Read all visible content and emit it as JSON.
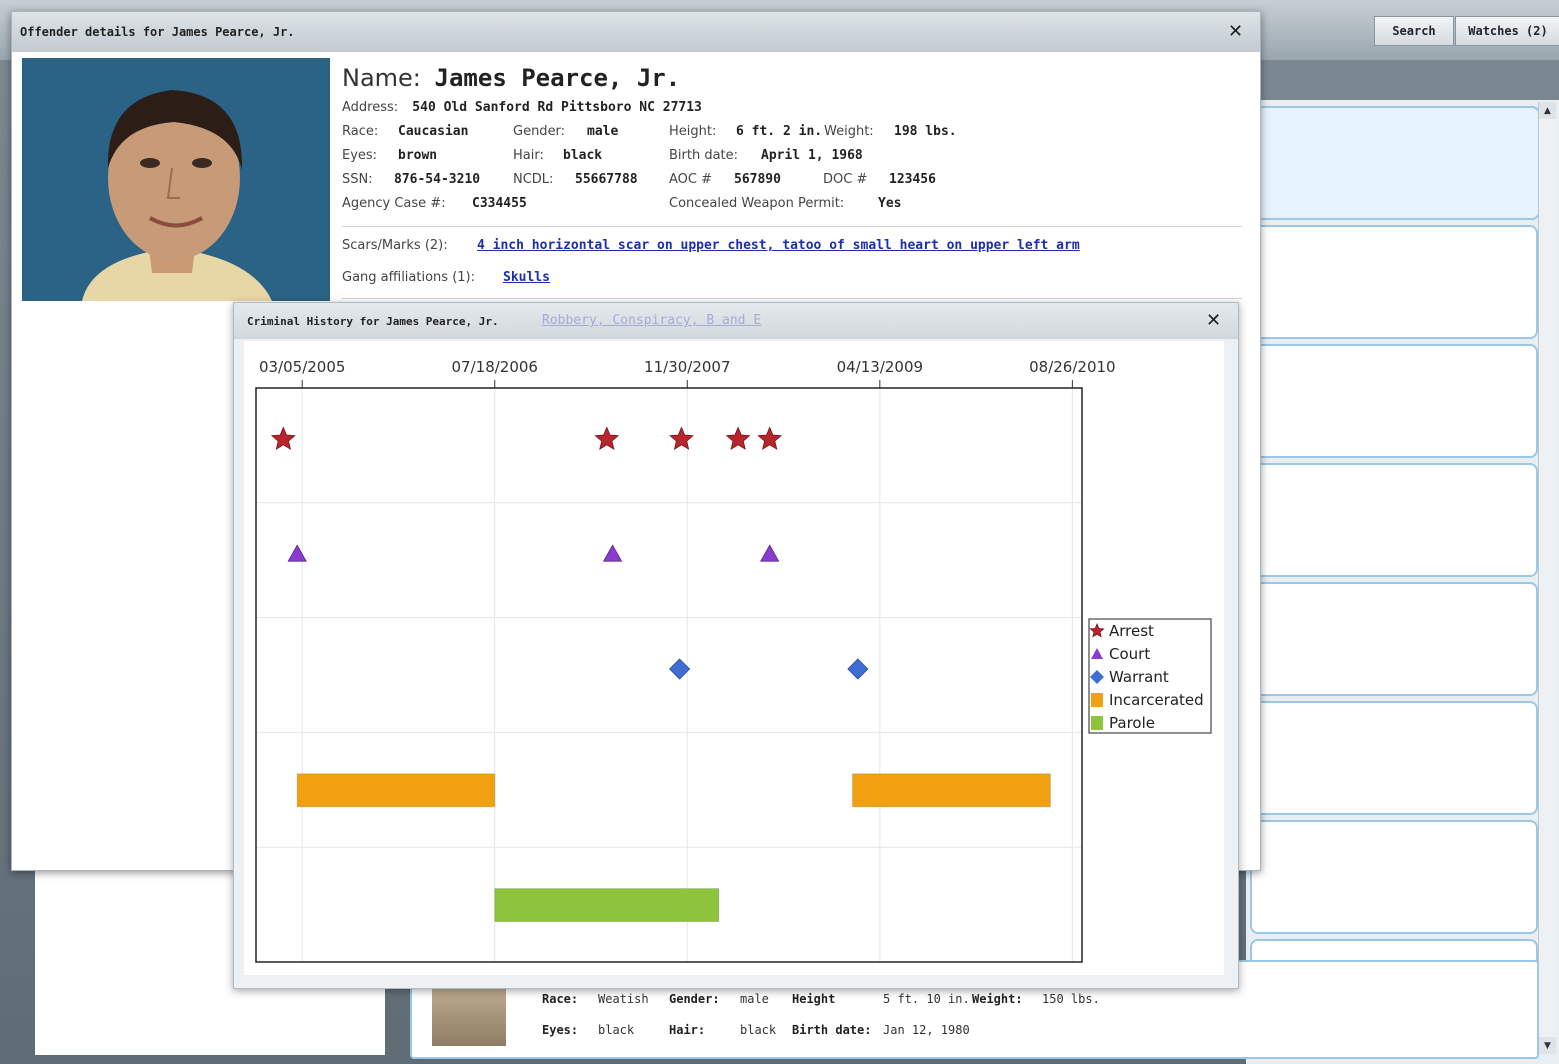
{
  "topbar": {
    "search_label": "Search",
    "watches_label": "Watches (2)"
  },
  "offender_window": {
    "title": "Offender details for James Pearce, Jr.",
    "close_glyph": "✕",
    "name_label": "Name:",
    "name_value": "James Pearce, Jr.",
    "address_label": "Address:",
    "address_value": "540 Old Sanford Rd Pittsboro NC 27713",
    "race_label": "Race:",
    "race_value": "Caucasian",
    "gender_label": "Gender:",
    "gender_value": "male",
    "height_label": "Height:",
    "height_value": "6 ft. 2 in.",
    "weight_label": "Weight:",
    "weight_value": "198 lbs.",
    "eyes_label": "Eyes:",
    "eyes_value": "brown",
    "hair_label": "Hair:",
    "hair_value": "black",
    "birth_label": "Birth date:",
    "birth_value": "April 1, 1968",
    "ssn_label": "SSN:",
    "ssn_value": "876-54-3210",
    "ncdl_label": "NCDL:",
    "ncdl_value": "55667788",
    "aoc_label": "AOC #",
    "aoc_value": "567890",
    "doc_label": "DOC #",
    "doc_value": "123456",
    "agency_label": "Agency Case #:",
    "agency_value": "C334455",
    "cwp_label": "Concealed Weapon Permit:",
    "cwp_value": "Yes",
    "scars_label": "Scars/Marks (2):",
    "scars_link": "4 inch horizontal scar on upper chest, tatoo of small heart on upper left arm",
    "gang_label": "Gang affiliations (1):",
    "gang_link": "Skulls"
  },
  "history_window": {
    "title": "Criminal History for James Pearce, Jr.",
    "tab_link": "Robbery, Conspiracy, B and E",
    "close_glyph": "✕"
  },
  "chart_data": {
    "type": "scatter",
    "x_ticks": [
      "03/05/2005",
      "07/18/2006",
      "11/30/2007",
      "04/13/2009",
      "08/26/2010"
    ],
    "xlim": [
      "2004-11-05",
      "2010-09-20"
    ],
    "rows": [
      "Arrest",
      "Court",
      "Warrant",
      "Incarcerated",
      "Parole"
    ],
    "grid": true,
    "legend_position": "right",
    "series": [
      {
        "name": "Arrest",
        "marker": "star",
        "color": "#b7262d",
        "x": [
          "2005-01-15",
          "2007-05-05",
          "2007-11-15",
          "2008-04-10",
          "2008-07-01"
        ]
      },
      {
        "name": "Court",
        "marker": "triangle",
        "color": "#8a3ccf",
        "x": [
          "2005-02-20",
          "2007-05-20",
          "2008-07-01"
        ]
      },
      {
        "name": "Warrant",
        "marker": "diamond",
        "color": "#3e6ed4",
        "x": [
          "2007-11-10",
          "2009-02-15"
        ]
      },
      {
        "name": "Incarcerated",
        "marker": "bar",
        "color": "#f0a010",
        "ranges": [
          [
            "2005-02-20",
            "2006-07-18"
          ],
          [
            "2009-02-01",
            "2010-06-30"
          ]
        ]
      },
      {
        "name": "Parole",
        "marker": "bar",
        "color": "#8cc43c",
        "ranges": [
          [
            "2006-07-18",
            "2008-02-20"
          ]
        ]
      }
    ]
  },
  "lower_card": {
    "race_label": "Race:",
    "race_value": "Weatish",
    "gender_label": "Gender:",
    "gender_value": "male",
    "height_label": "Height",
    "height_value": "5 ft. 10 in.",
    "weight_label": "Weight:",
    "weight_value": "150 lbs.",
    "eyes_label": "Eyes:",
    "eyes_value": "black",
    "hair_label": "Hair:",
    "hair_value": "black",
    "birth_label": "Birth date:",
    "birth_value": "Jan 12, 1980"
  }
}
